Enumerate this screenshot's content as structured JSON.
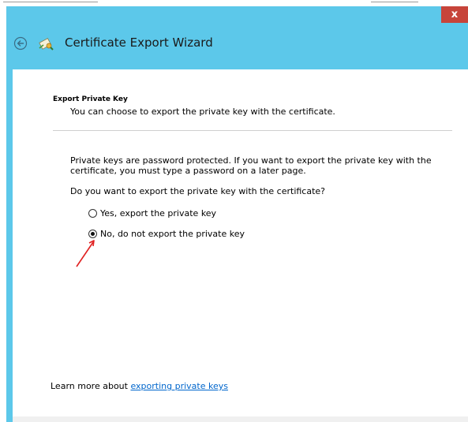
{
  "window": {
    "title": "Certificate Export Wizard",
    "close_label": "x",
    "accent_color": "#5cc8ea",
    "close_color": "#c7443a"
  },
  "page": {
    "heading": "Export Private Key",
    "description": "You can choose to export the private key with the certificate.",
    "paragraph": "Private keys are password protected. If you want to export the private key with the certificate, you must type a password on a later page.",
    "question": "Do you want to export the private key with the certificate?",
    "options": [
      {
        "label": "Yes, export the private key",
        "selected": false
      },
      {
        "label": "No, do not export the private key",
        "selected": true
      }
    ],
    "learn_more_prefix": "Learn more about",
    "learn_more_link": "exporting private keys",
    "link_color": "#0066cc"
  },
  "annotation": {
    "arrow_color": "#e02020"
  },
  "icons": {
    "back": "back-arrow-icon",
    "wizard": "certificate-icon"
  }
}
